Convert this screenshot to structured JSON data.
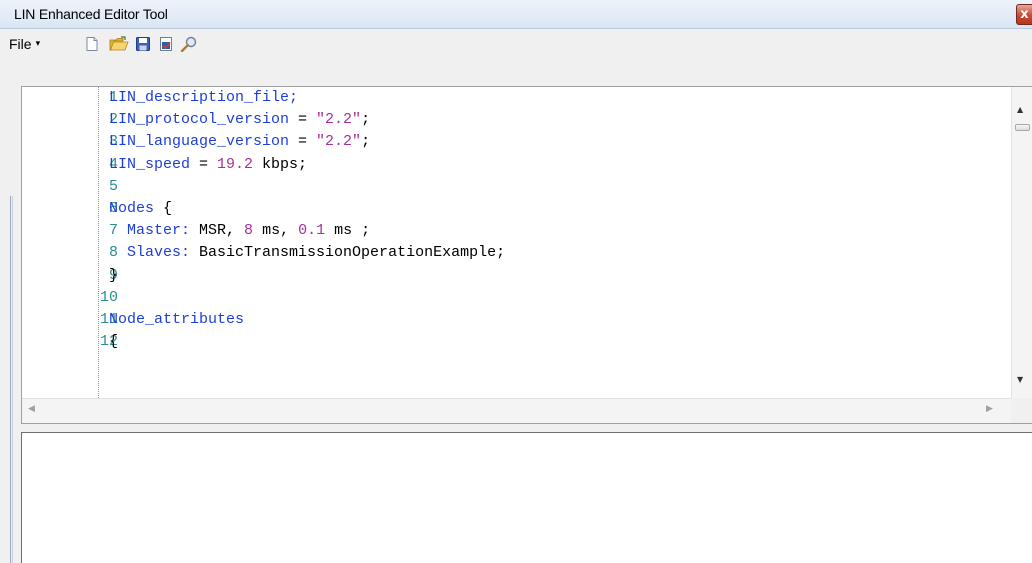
{
  "window": {
    "title": "LIN Enhanced Editor Tool",
    "close_glyph": "x"
  },
  "toolbar": {
    "file_label": "File",
    "file_arrow_glyph": "▾",
    "icons": [
      "new-file-icon",
      "open-folder-icon",
      "save-icon",
      "check-document-icon",
      "search-icon"
    ]
  },
  "editor": {
    "lines": [
      {
        "num": "1",
        "parts": [
          {
            "t": "LIN_description_file;",
            "c": "kw"
          }
        ]
      },
      {
        "num": "2",
        "parts": [
          {
            "t": "LIN_protocol_version",
            "c": "kw"
          },
          {
            "t": " = ",
            "c": ""
          },
          {
            "t": "\"2.2\"",
            "c": "str"
          },
          {
            "t": ";",
            "c": ""
          }
        ]
      },
      {
        "num": "3",
        "parts": [
          {
            "t": "LIN_language_version",
            "c": "kw"
          },
          {
            "t": " = ",
            "c": ""
          },
          {
            "t": "\"2.2\"",
            "c": "str"
          },
          {
            "t": ";",
            "c": ""
          }
        ]
      },
      {
        "num": "4",
        "parts": [
          {
            "t": "LIN_speed",
            "c": "kw"
          },
          {
            "t": " = ",
            "c": ""
          },
          {
            "t": "19.2",
            "c": "num"
          },
          {
            "t": " kbps;",
            "c": ""
          }
        ]
      },
      {
        "num": "5",
        "parts": []
      },
      {
        "num": "6",
        "parts": [
          {
            "t": "Nodes",
            "c": "kw"
          },
          {
            "t": " {",
            "c": ""
          }
        ]
      },
      {
        "num": "7",
        "parts": [
          {
            "t": "  ",
            "c": ""
          },
          {
            "t": "Master:",
            "c": "fld"
          },
          {
            "t": " MSR, ",
            "c": ""
          },
          {
            "t": "8",
            "c": "num"
          },
          {
            "t": " ms, ",
            "c": ""
          },
          {
            "t": "0.1",
            "c": "num"
          },
          {
            "t": " ms ;",
            "c": ""
          }
        ]
      },
      {
        "num": "8",
        "parts": [
          {
            "t": "  ",
            "c": ""
          },
          {
            "t": "Slaves:",
            "c": "fld"
          },
          {
            "t": " BasicTransmissionOperationExample;",
            "c": ""
          }
        ]
      },
      {
        "num": "9",
        "parts": [
          {
            "t": "}",
            "c": ""
          }
        ]
      },
      {
        "num": "10",
        "parts": []
      },
      {
        "num": "11",
        "parts": [
          {
            "t": "Node_attributes",
            "c": "kw"
          }
        ]
      },
      {
        "num": "12",
        "parts": [
          {
            "t": "{",
            "c": ""
          }
        ]
      }
    ]
  },
  "scrollbars": {
    "up_glyph": "▲",
    "down_glyph": "▼",
    "left_glyph": "◀",
    "right_glyph": "▶"
  },
  "output": {
    "text": ""
  },
  "colors": {
    "keyword": "#1d3fd9",
    "literal": "#a6309a",
    "line_number": "#2b8f8f"
  }
}
